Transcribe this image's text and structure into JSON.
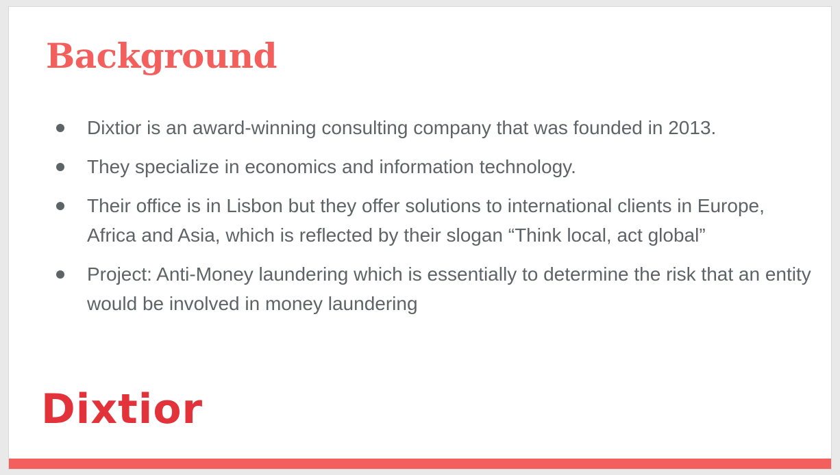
{
  "slide": {
    "title": "Background",
    "bullets": [
      "Dixtior is an award-winning consulting company that was founded in 2013.",
      "They specialize in economics and information technology.",
      "Their office is in Lisbon but they offer solutions to international clients in Europe, Africa and Asia, which is reflected by their slogan “Think local, act global”",
      "Project: Anti-Money laundering which is essentially to determine the risk that an entity would be involved in money laundering"
    ],
    "logo_text": "Dixtior"
  },
  "colors": {
    "accent": "#f25f5c",
    "logo": "#e3333a",
    "body_text": "#5e6366",
    "background": "#ffffff"
  }
}
